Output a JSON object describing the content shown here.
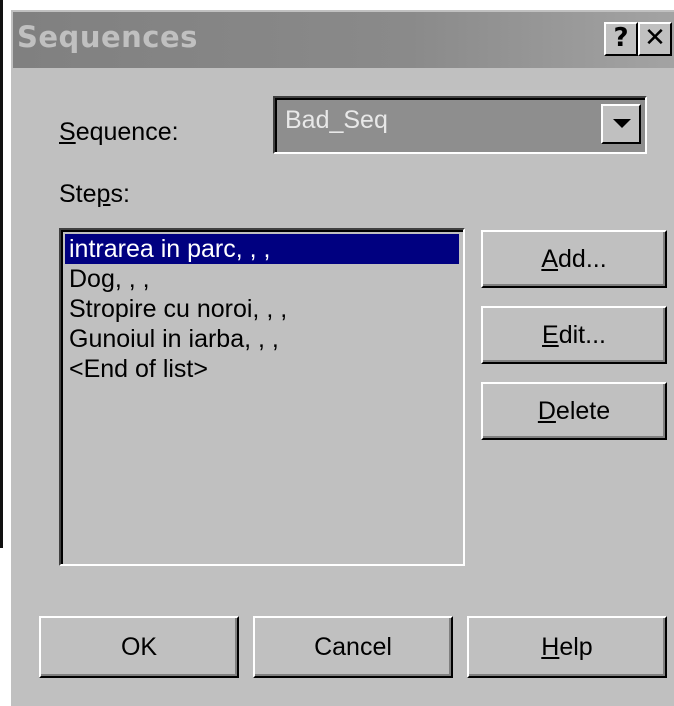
{
  "dialog": {
    "title": "Sequences",
    "help_glyph": "?",
    "close_glyph": "✕"
  },
  "sequence": {
    "label_accel": "S",
    "label_rest": "equence:",
    "selected_value": "Bad_Seq"
  },
  "steps": {
    "label_pre": "Ste",
    "label_accel": "p",
    "label_post": "s:",
    "items": [
      "intrarea in parc, , ,",
      "Dog, , ,",
      "Stropire cu noroi, , ,",
      "Gunoiul in iarba, , ,",
      "<End of list>"
    ],
    "selected_index": 0
  },
  "buttons": {
    "add": {
      "accel": "A",
      "rest": "dd..."
    },
    "edit": {
      "accel": "E",
      "rest": "dit..."
    },
    "delete": {
      "accel": "D",
      "rest": "elete"
    },
    "ok": {
      "label": "OK"
    },
    "cancel": {
      "label": "Cancel"
    },
    "help": {
      "accel": "H",
      "rest": "elp"
    }
  },
  "colors": {
    "face": "#c0c0c0",
    "selection": "#000080",
    "titlebar": "#808080"
  }
}
